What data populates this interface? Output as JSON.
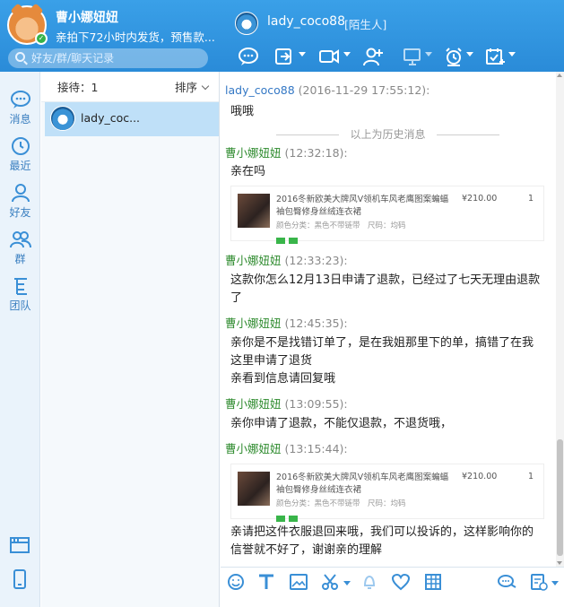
{
  "header": {
    "my_name": "曹小娜妞妞",
    "my_status": "亲拍下72小时内发货，预售款...",
    "search_placeholder": "好友/群/聊天记录",
    "chat_name": "lady_coco88",
    "chat_tag": "[陌生人]"
  },
  "toolbar": {
    "icons": [
      "chat-bubble-icon",
      "transfer-icon",
      "video-icon",
      "add-contact-icon",
      "screen-share-icon",
      "alarm-icon",
      "calendar-check-icon"
    ]
  },
  "nav": {
    "items": [
      {
        "label": "消息",
        "icon": "message-icon"
      },
      {
        "label": "最近",
        "icon": "clock-icon"
      },
      {
        "label": "好友",
        "icon": "person-icon"
      },
      {
        "label": "群",
        "icon": "group-icon"
      },
      {
        "label": "团队",
        "icon": "team-icon"
      }
    ]
  },
  "contacts": {
    "header_label": "接待：1",
    "sort_label": "排序",
    "items": [
      {
        "name": "lady_coc..."
      }
    ]
  },
  "chat": {
    "messages": {
      "m0_sender": "lady_coco88",
      "m0_time": "(2016-11-29 17:55:12):",
      "m0_text": "哦哦",
      "history_divider": "以上为历史消息",
      "m1_sender": "曹小娜妞妞",
      "m1_time": "(12:32:18):",
      "m1_text": "亲在吗",
      "m2_sender": "曹小娜妞妞",
      "m2_time": "(12:33:23):",
      "m2_text": "这款你怎么12月13日申请了退款，已经过了七天无理由退款了",
      "m3_sender": "曹小娜妞妞",
      "m3_time": "(12:45:35):",
      "m3_text": "亲你是不是找错订单了，是在我姐那里下的单，搞错了在我这里申请了退货",
      "m3_text2": "亲看到信息请回复哦",
      "m4_sender": "曹小娜妞妞",
      "m4_time": "(13:09:55):",
      "m4_text": "亲你申请了退款，不能仅退款，不退货哦，",
      "m5_sender": "曹小娜妞妞",
      "m5_time": "(13:15:44):",
      "m5_text": "亲请把这件衣服退回来哦，我们可以投诉的，这样影响你的信誉就不好了，谢谢亲的理解"
    },
    "product_card": {
      "title": "2016冬新欧美大牌风V领机车风老鹰图案蝙蝠袖包臀修身丝绒连衣裙",
      "price": "¥210.00",
      "qty": "1",
      "spec": "颜色分类：黑色不带链带　尺码：均码"
    }
  },
  "bottom_toolbar": {
    "icons": [
      "emoji-icon",
      "font-icon",
      "image-icon",
      "scissors-icon",
      "shake-icon",
      "heart-icon",
      "table-icon",
      "quick-reply-icon",
      "history-icon"
    ]
  },
  "colors": {
    "header_bg": "#2a8bd8",
    "sender_green": "#2e8b2e",
    "selected_contact": "#bfe0f8"
  }
}
